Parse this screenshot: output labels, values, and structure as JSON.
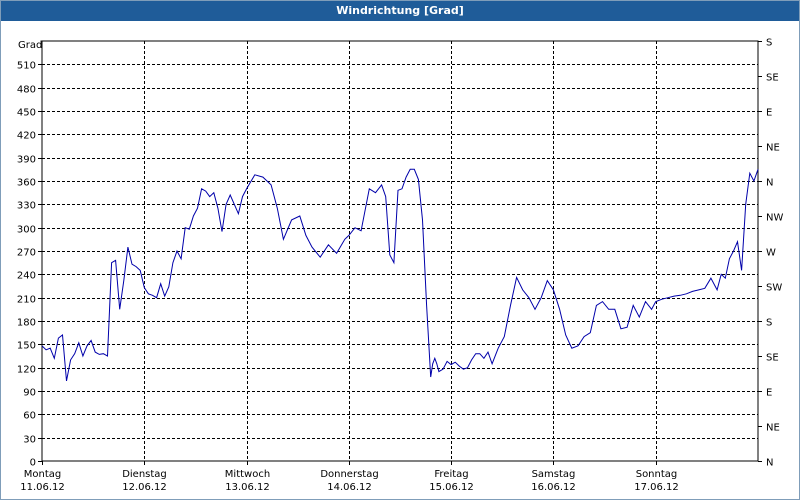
{
  "window": {
    "title": "Windrichtung [Grad]"
  },
  "chart_data": {
    "type": "line",
    "title": "Windrichtung [Grad]",
    "ylabel": "Grad",
    "ylim": [
      0,
      540
    ],
    "yticks": [
      0,
      30,
      60,
      90,
      120,
      150,
      180,
      210,
      240,
      270,
      300,
      330,
      360,
      390,
      420,
      450,
      480,
      510
    ],
    "right_axis_labels": [
      "N",
      "NE",
      "E",
      "SE",
      "S",
      "SW",
      "W",
      "NW",
      "N",
      "NE",
      "E",
      "SE",
      "S"
    ],
    "right_axis_values": [
      0,
      45,
      90,
      135,
      180,
      225,
      270,
      315,
      360,
      405,
      450,
      495,
      540
    ],
    "x_range": [
      0,
      7
    ],
    "x_categories": [
      {
        "day": "Montag",
        "date": "11.06.12"
      },
      {
        "day": "Dienstag",
        "date": "12.06.12"
      },
      {
        "day": "Mittwoch",
        "date": "13.06.12"
      },
      {
        "day": "Donnerstag",
        "date": "14.06.12"
      },
      {
        "day": "Freitag",
        "date": "15.06.12"
      },
      {
        "day": "Samstag",
        "date": "16.06.12"
      },
      {
        "day": "Sonntag",
        "date": "17.06.12"
      }
    ],
    "grid": true,
    "line_color": "#0000aa",
    "series": [
      {
        "x": [
          0,
          0.04,
          0.08,
          0.12,
          0.16,
          0.2,
          0.24,
          0.28,
          0.32,
          0.36,
          0.4,
          0.44,
          0.48,
          0.52,
          0.56,
          0.6,
          0.64,
          0.68,
          0.72,
          0.76,
          0.8,
          0.84,
          0.88,
          0.92,
          0.96,
          1.0,
          1.04,
          1.08,
          1.12,
          1.16,
          1.2,
          1.24,
          1.28,
          1.32,
          1.36,
          1.4,
          1.44,
          1.48,
          1.52,
          1.56,
          1.6,
          1.64,
          1.68,
          1.72,
          1.76,
          1.8,
          1.84,
          1.88,
          1.92,
          1.96,
          2.0,
          2.08,
          2.16,
          2.24,
          2.3,
          2.36,
          2.44,
          2.52,
          2.58,
          2.64,
          2.72,
          2.8,
          2.88,
          2.96,
          3.0,
          3.06,
          3.12,
          3.2,
          3.26,
          3.32,
          3.36,
          3.4,
          3.44,
          3.48,
          3.52,
          3.56,
          3.6,
          3.64,
          3.68,
          3.72,
          3.76,
          3.8,
          3.82,
          3.84,
          3.86,
          3.88,
          3.92,
          3.96,
          4.0,
          4.04,
          4.08,
          4.12,
          4.16,
          4.2,
          4.24,
          4.28,
          4.32,
          4.36,
          4.4,
          4.46,
          4.52,
          4.58,
          4.64,
          4.7,
          4.76,
          4.82,
          4.88,
          4.94,
          5.0,
          5.06,
          5.12,
          5.18,
          5.24,
          5.3,
          5.36,
          5.42,
          5.48,
          5.54,
          5.6,
          5.66,
          5.72,
          5.78,
          5.84,
          5.9,
          5.96,
          6.0,
          6.06,
          6.12,
          6.18,
          6.24,
          6.3,
          6.36,
          6.42,
          6.48,
          6.54,
          6.6,
          6.64,
          6.68,
          6.72,
          6.76,
          6.8,
          6.84,
          6.88,
          6.92,
          6.96,
          7.0
        ],
        "y": [
          148,
          143,
          145,
          132,
          158,
          162,
          103,
          130,
          138,
          152,
          135,
          148,
          155,
          140,
          137,
          138,
          135,
          255,
          258,
          195,
          232,
          275,
          253,
          250,
          245,
          223,
          215,
          213,
          210,
          228,
          212,
          224,
          255,
          270,
          260,
          300,
          298,
          315,
          325,
          350,
          347,
          340,
          345,
          325,
          295,
          330,
          342,
          330,
          318,
          340,
          350,
          368,
          365,
          355,
          325,
          285,
          310,
          315,
          290,
          275,
          262,
          278,
          267,
          285,
          290,
          300,
          296,
          350,
          345,
          355,
          340,
          265,
          255,
          348,
          350,
          365,
          375,
          375,
          362,
          310,
          200,
          108,
          125,
          132,
          125,
          115,
          118,
          128,
          124,
          127,
          122,
          118,
          120,
          130,
          138,
          138,
          132,
          140,
          125,
          145,
          160,
          200,
          236,
          220,
          210,
          195,
          210,
          232,
          220,
          195,
          162,
          145,
          148,
          160,
          165,
          200,
          205,
          195,
          195,
          170,
          172,
          200,
          185,
          205,
          195,
          205,
          208,
          210,
          212,
          213,
          215,
          218,
          220,
          222,
          235,
          220,
          240,
          235,
          260,
          270,
          282,
          245,
          330,
          370,
          360,
          375
        ]
      }
    ]
  }
}
